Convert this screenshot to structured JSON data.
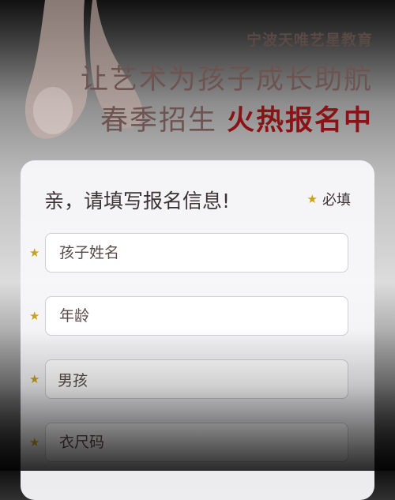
{
  "hero": {
    "brand": "宁波天唯艺星教育",
    "slogan_line1": "让艺术为孩子成长助航",
    "slogan_line2_prefix": "春季招生",
    "slogan_line2_hot": "火热报名中",
    "colors": {
      "slogan": "#6d5450",
      "hot": "#8b1216"
    }
  },
  "form": {
    "title": "亲，请填写报名信息!",
    "required_legend": "必填",
    "fields": [
      {
        "name": "child_name",
        "placeholder": "孩子姓名"
      },
      {
        "name": "age",
        "placeholder": "年龄"
      },
      {
        "name": "gender",
        "value": "男孩"
      },
      {
        "name": "size",
        "placeholder": "衣尺码"
      }
    ]
  }
}
